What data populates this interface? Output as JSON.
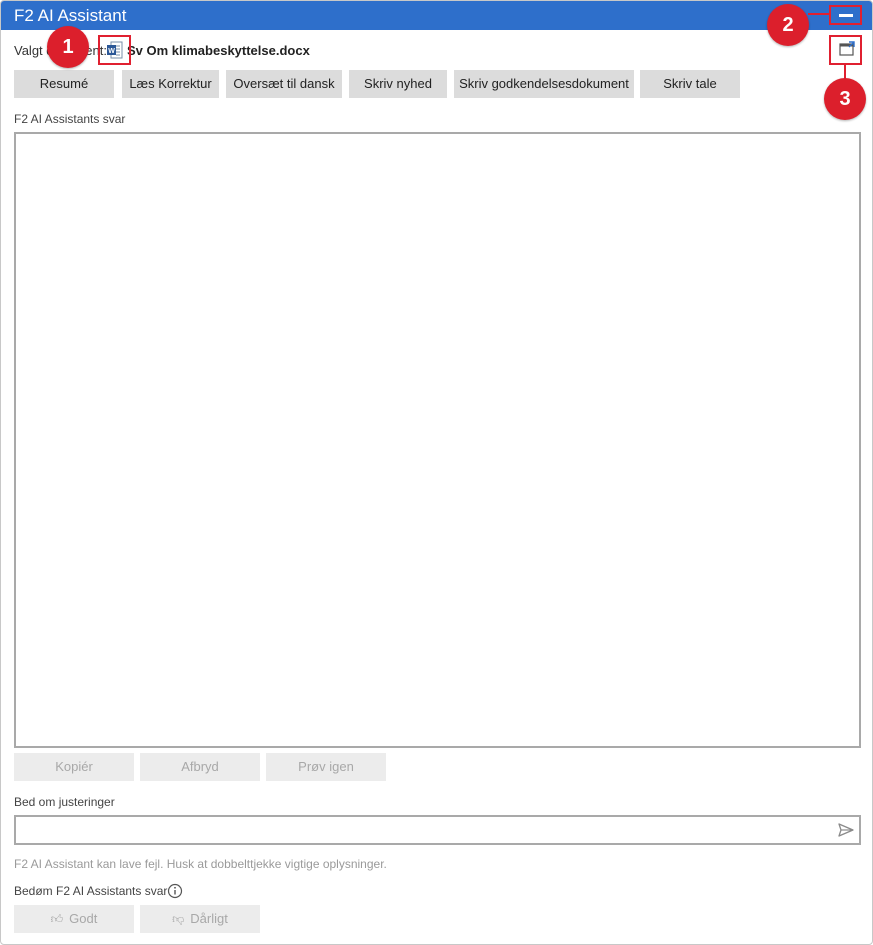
{
  "window": {
    "title": "F2 AI Assistant"
  },
  "selection": {
    "label": "Valgt dokument:",
    "document_name": "Sv Om klimabeskyttelse.docx",
    "document_icon": "word-document-icon"
  },
  "actions": [
    {
      "label": "Resumé"
    },
    {
      "label": "Læs Korrektur"
    },
    {
      "label": "Oversæt til dansk"
    },
    {
      "label": "Skriv nyhed"
    },
    {
      "label": "Skriv godkendelsesdokument"
    },
    {
      "label": "Skriv tale"
    }
  ],
  "response": {
    "label": "F2 AI Assistants svar",
    "text": ""
  },
  "response_actions": {
    "copy": "Kopiér",
    "abort": "Afbryd",
    "retry": "Prøv igen"
  },
  "adjust": {
    "label": "Bed om justeringer",
    "value": "",
    "placeholder": ""
  },
  "disclaimer": "F2 AI Assistant kan lave fejl. Husk at dobbelttjekke vigtige oplysninger.",
  "rating": {
    "label": "Bedøm F2 AI Assistants svar",
    "good": "Godt",
    "bad": "Dårligt"
  },
  "callouts": [
    "1",
    "2",
    "3"
  ],
  "colors": {
    "titlebar": "#2e6fcb",
    "callout": "#dc1f2c",
    "button": "#dcdcdc"
  }
}
